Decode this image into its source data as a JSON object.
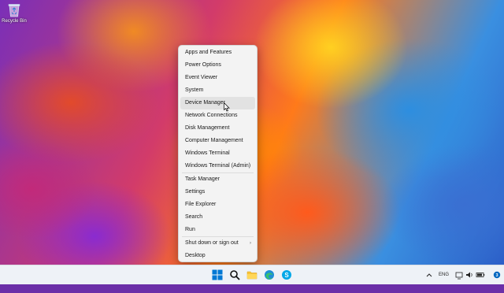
{
  "desktop": {
    "icons": [
      {
        "label": "Recycle Bin",
        "icon": "recycle-bin-icon"
      }
    ]
  },
  "context_menu": {
    "items": [
      {
        "label": "Apps and Features"
      },
      {
        "label": "Power Options"
      },
      {
        "label": "Event Viewer"
      },
      {
        "label": "System"
      },
      {
        "label": "Device Manager",
        "hovered": true
      },
      {
        "label": "Network Connections"
      },
      {
        "label": "Disk Management"
      },
      {
        "label": "Computer Management"
      },
      {
        "label": "Windows Terminal"
      },
      {
        "label": "Windows Terminal (Admin)"
      },
      {
        "label": "Task Manager"
      },
      {
        "label": "Settings"
      },
      {
        "label": "File Explorer"
      },
      {
        "label": "Search"
      },
      {
        "label": "Run"
      },
      {
        "label": "Shut down or sign out",
        "submenu": true
      },
      {
        "label": "Desktop"
      }
    ]
  },
  "taskbar": {
    "icons": [
      "start-icon",
      "search-icon",
      "file-explorer-icon",
      "edge-icon",
      "skype-icon"
    ],
    "tray": {
      "language": "ENG",
      "icons": [
        "chevron-up-icon",
        "network-icon",
        "volume-icon",
        "battery-icon",
        "notification-icon"
      ]
    }
  },
  "colors": {
    "accent": "#0067c0",
    "menu_bg": "#f3f3f3",
    "menu_hover": "#e2e2e2",
    "taskbar_bg": "#eef2f7"
  }
}
